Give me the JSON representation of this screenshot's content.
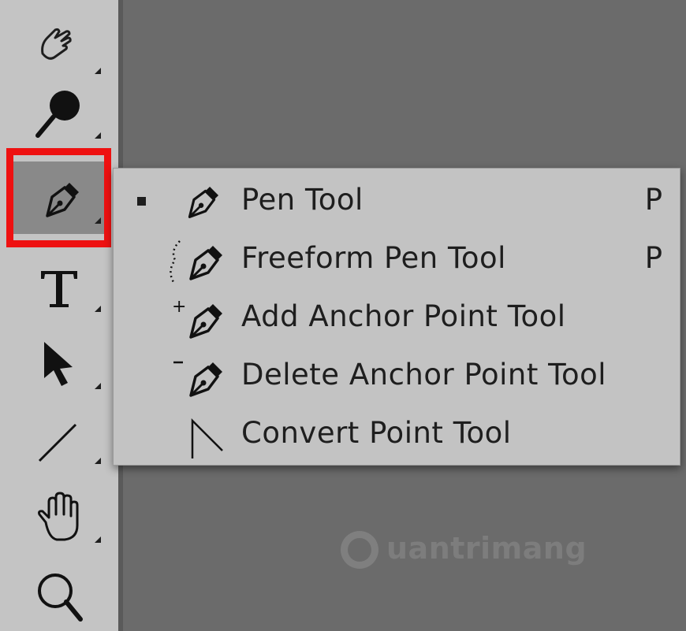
{
  "toolbar": {
    "tools": [
      {
        "name": "smudge-tool",
        "icon": "finger-icon"
      },
      {
        "name": "dodge-tool",
        "icon": "dodge-icon"
      },
      {
        "name": "pen-tool",
        "icon": "pen-nib-icon",
        "active": true
      },
      {
        "name": "type-tool",
        "icon": "type-t-icon",
        "glyph": "T"
      },
      {
        "name": "path-selection-tool",
        "icon": "arrow-cursor-icon"
      },
      {
        "name": "line-tool",
        "icon": "line-icon"
      },
      {
        "name": "hand-tool",
        "icon": "hand-icon"
      },
      {
        "name": "zoom-tool",
        "icon": "magnifier-icon"
      }
    ]
  },
  "flyout": {
    "items": [
      {
        "label": "Pen Tool",
        "shortcut": "P",
        "selected": true,
        "icon": "pen-nib-icon"
      },
      {
        "label": "Freeform Pen Tool",
        "shortcut": "P",
        "selected": false,
        "icon": "freeform-pen-icon"
      },
      {
        "label": "Add Anchor Point Tool",
        "shortcut": "",
        "selected": false,
        "icon": "add-anchor-pen-icon"
      },
      {
        "label": "Delete Anchor Point Tool",
        "shortcut": "",
        "selected": false,
        "icon": "delete-anchor-pen-icon"
      },
      {
        "label": "Convert Point Tool",
        "shortcut": "",
        "selected": false,
        "icon": "convert-point-icon"
      }
    ]
  },
  "watermark": {
    "text": "uantrimang"
  },
  "colors": {
    "highlight": "#ee1111",
    "canvas": "#6b6b6b",
    "panel": "#c4c4c4"
  }
}
